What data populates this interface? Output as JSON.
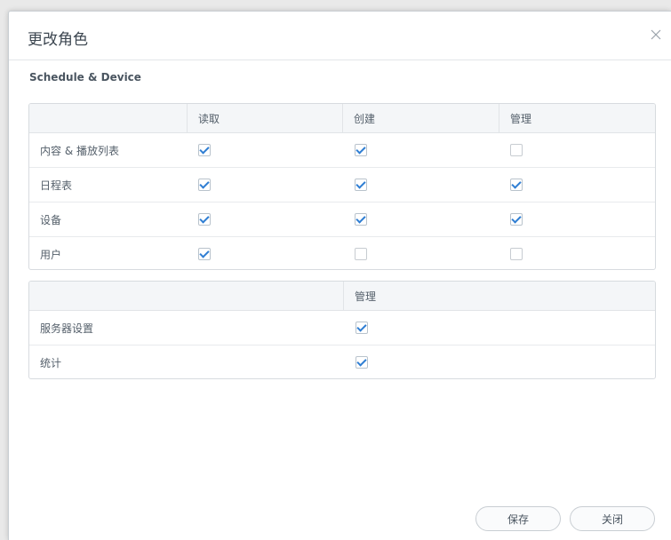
{
  "dialog": {
    "title": "更改角色",
    "close_icon": "close-icon"
  },
  "section": {
    "title": "Schedule & Device"
  },
  "table1": {
    "headers": [
      "",
      "读取",
      "创建",
      "管理"
    ],
    "rows": [
      {
        "label": "内容 & 播放列表",
        "read": true,
        "create": true,
        "manage": false
      },
      {
        "label": "日程表",
        "read": true,
        "create": true,
        "manage": true
      },
      {
        "label": "设备",
        "read": true,
        "create": true,
        "manage": true
      },
      {
        "label": "用户",
        "read": true,
        "create": false,
        "manage": false
      }
    ]
  },
  "table2": {
    "headers": [
      "",
      "管理"
    ],
    "rows": [
      {
        "label": "服务器设置",
        "manage": true
      },
      {
        "label": "统计",
        "manage": true
      }
    ]
  },
  "buttons": {
    "save": "保存",
    "close": "关闭"
  },
  "colors": {
    "check": "#2f7ed3",
    "border": "#d7dbdf",
    "header_bg": "#f4f6f8"
  }
}
